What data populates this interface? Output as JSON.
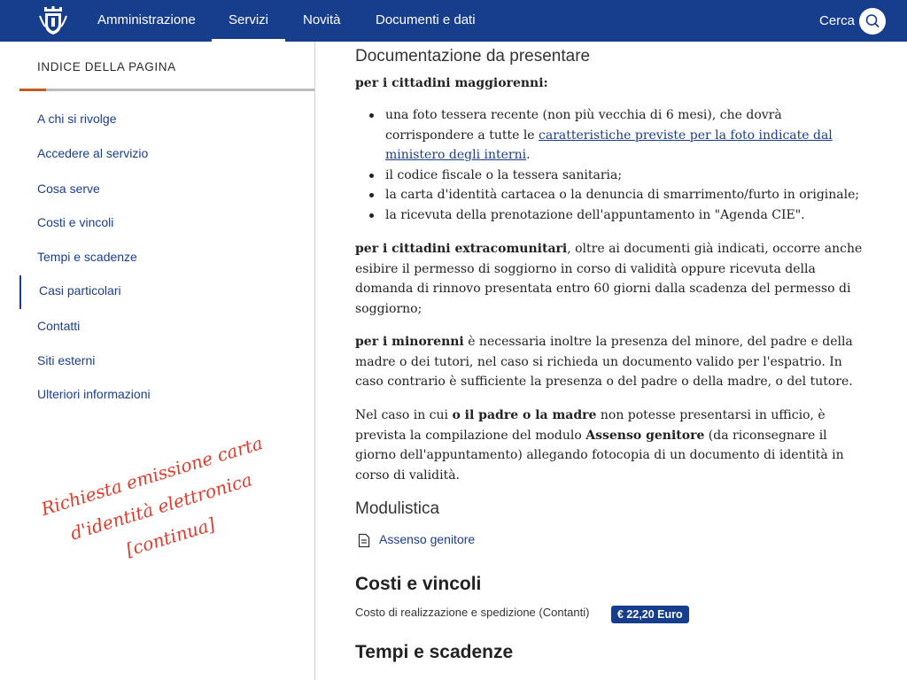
{
  "header": {
    "nav": [
      {
        "label": "Amministrazione",
        "active": false
      },
      {
        "label": "Servizi",
        "active": true
      },
      {
        "label": "Novità",
        "active": false
      },
      {
        "label": "Documenti e dati",
        "active": false
      }
    ],
    "search_label": "Cerca",
    "logo_icon": "municipal-crest-icon",
    "search_icon": "search-icon",
    "color": "#163e8c"
  },
  "sidebar": {
    "title": "INDICE DELLA PAGINA",
    "read_progress": 0.09,
    "progress_color": "#c35a1f",
    "items": [
      {
        "label": "A chi si rivolge"
      },
      {
        "label": "Accedere al servizio"
      },
      {
        "label": "Cosa serve"
      },
      {
        "label": "Costi e vincoli"
      },
      {
        "label": "Tempi e scadenze"
      },
      {
        "label": "Casi particolari",
        "active": true
      },
      {
        "label": "Contatti"
      },
      {
        "label": "Siti esterni"
      },
      {
        "label": "Ulteriori informazioni"
      }
    ],
    "annotation": {
      "line1": "Richiesta emissione carta",
      "line2": "d'identità elettronica [continua]",
      "color": "#e23b2c"
    }
  },
  "main": {
    "doc_heading": "Documentazione da presentare",
    "adults_heading": "per i cittadini maggiorenni",
    "adults_heading_suffix": ":",
    "bullets": {
      "b1_text": "una foto tessera recente (non più vecchia di 6 mesi), che dovrà corrispondere a tutte le ",
      "b1_link": "caratteristiche previste per la foto indicate dal ministero degli interni",
      "b1_end": ".",
      "b2": "il codice fiscale o la tessera sanitaria;",
      "b3": "la carta d'identità cartacea o la denuncia di smarrimento/furto in originale;",
      "b4": "la ricevuta della prenotazione dell'appuntamento in \"Agenda CIE\"."
    },
    "extra": {
      "bold": "per i cittadini extracomunitari",
      "text": ", oltre ai documenti già indicati, occorre anche esibire il permesso di soggiorno in corso di validità oppure ricevuta della domanda di rinnovo presentata entro 60 giorni dalla scadenza del permesso di soggiorno;"
    },
    "minors": {
      "bold": "per i minorenni",
      "text": " è necessaria inoltre la presenza del minore, del padre e della madre o dei tutori, nel caso si richieda un documento valido per l'espatrio. In caso contrario è sufficiente la presenza o del padre o della madre, o del tutore."
    },
    "parent": {
      "t1": "Nel caso in cui ",
      "b1": "o il padre o la madre",
      "t2": " non potesse presentarsi in ufficio, è prevista la compilazione del modulo ",
      "b2": "Assenso genitore",
      "t3": " (da riconsegnare il giorno dell'appuntamento) allegando fotocopia di un documento di identità in corso di validità."
    },
    "forms_heading": "Modulistica",
    "form_link": "Assenso genitore",
    "form_icon": "document-icon",
    "costs_heading": "Costi e vincoli",
    "cost_label": "Costo di realizzazione e spedizione (Contanti)",
    "cost_value": "€ 22,20 Euro",
    "times_heading": "Tempi e scadenze",
    "accent_color": "#1a3e8a"
  }
}
